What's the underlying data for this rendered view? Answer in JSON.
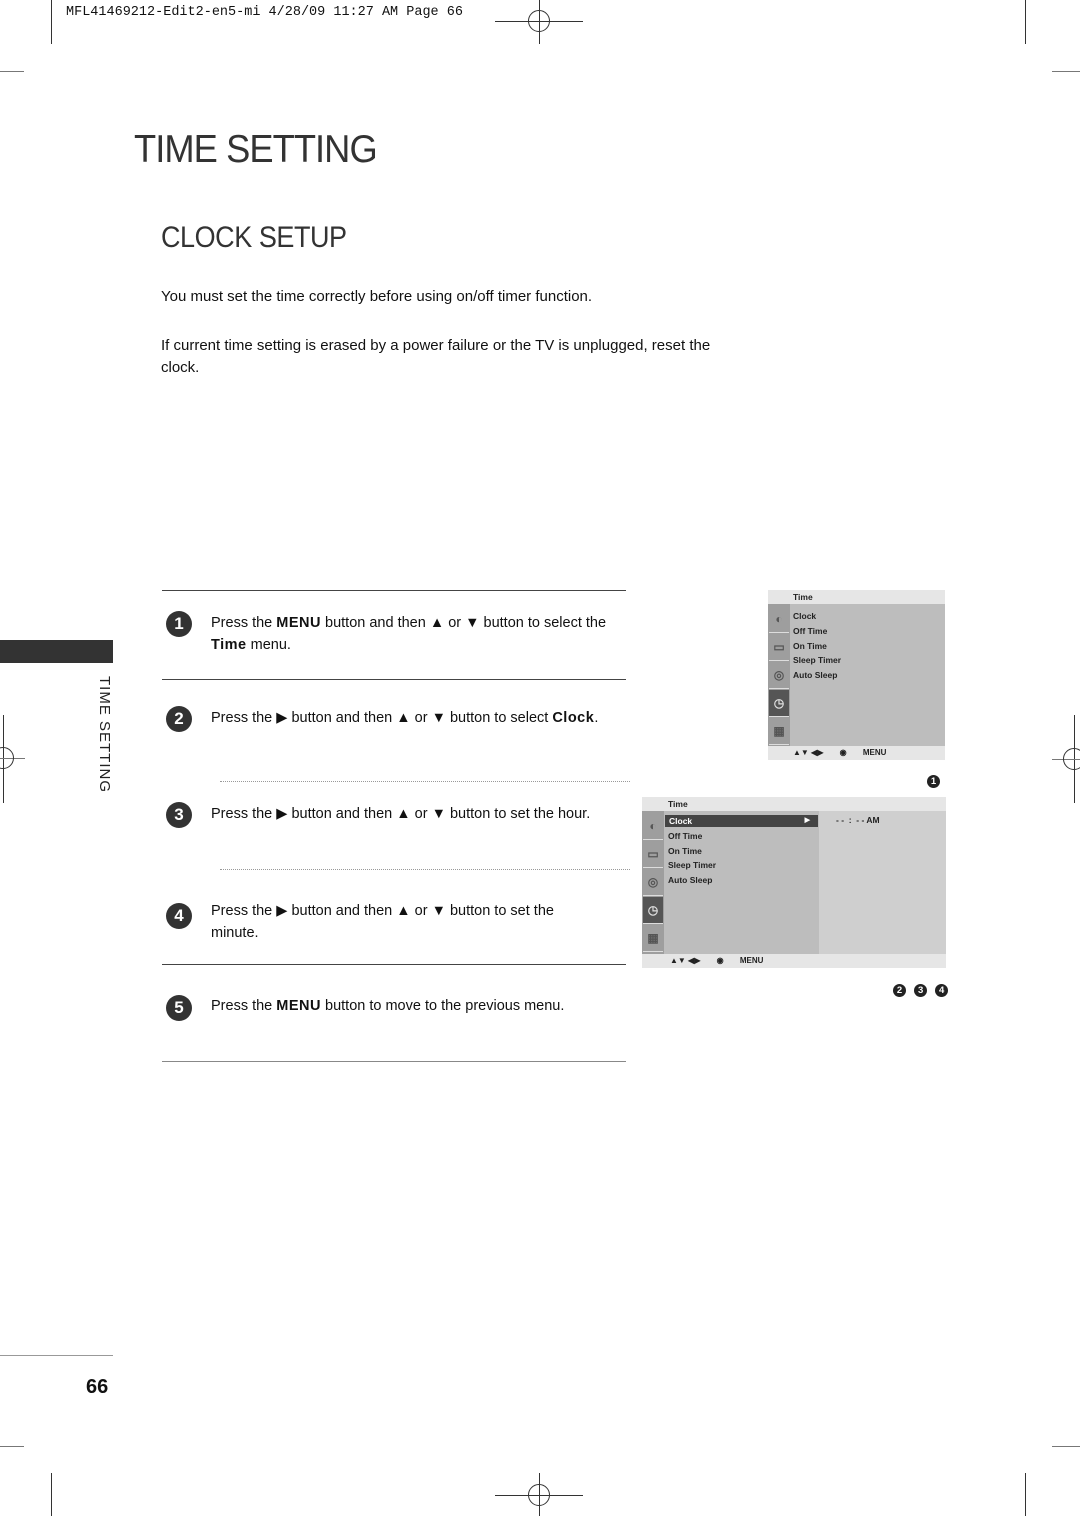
{
  "slug": "MFL41469212-Edit2-en5-mi  4/28/09 11:27 AM  Page 66",
  "title": "TIME SETTING",
  "subtitle": "CLOCK SETUP",
  "intro": [
    "You must set the time correctly before using on/off timer function.",
    "If current time setting is erased by a power failure or the TV is unplugged, reset the clock."
  ],
  "side_label": "TIME SETTING",
  "steps": [
    {
      "num": "1",
      "pre": "Press the ",
      "bold1": "MENU",
      "mid": " button and then ▲ or ▼ button to select the ",
      "bold2": "Time",
      "post": "  menu."
    },
    {
      "num": "2",
      "pre": "Press the ▶ button and then ▲ or ▼ button to select ",
      "bold1": "Clock",
      "post": "."
    },
    {
      "num": "3",
      "text": "Press the ▶ button and then ▲ or ▼ button to set the hour."
    },
    {
      "num": "4",
      "text": "Press the ▶ button and then ▲ or ▼ button to set the minute."
    },
    {
      "num": "5",
      "pre": "Press the ",
      "bold1": "MENU",
      "post": " button to move to the previous menu."
    }
  ],
  "osd1": {
    "title": "Time",
    "items": [
      "Clock",
      "Off Time",
      "On Time",
      "Sleep Timer",
      "Auto Sleep"
    ],
    "icons": [
      "picture-icon",
      "tv-icon",
      "speaker-icon",
      "clock-icon",
      "lock-icon"
    ],
    "footer": {
      "nav": "▲▼  ◀▶",
      "ok": "◉",
      "menu": "MENU"
    },
    "callout": [
      "1"
    ]
  },
  "osd2": {
    "title": "Time",
    "items": [
      "Clock",
      "Off Time",
      "On Time",
      "Sleep Timer",
      "Auto Sleep"
    ],
    "selected": "Clock",
    "selected_arrow": "▶",
    "value": "- -  :  - - AM",
    "footer": {
      "nav": "▲▼  ◀▶",
      "ok": "◉",
      "menu": "MENU"
    },
    "callout": [
      "2",
      "3",
      "4"
    ]
  },
  "page_number": "66"
}
